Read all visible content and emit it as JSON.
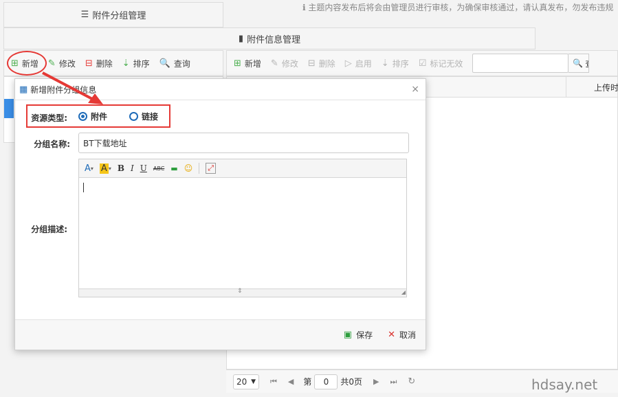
{
  "notice": "主题内容发布后将会由管理员进行审核，为确保审核通过，请认真发布，勿发布违规",
  "tabs": {
    "group_mgmt": "附件分组管理",
    "info_mgmt": "附件信息管理"
  },
  "left_toolbar": [
    "新增",
    "修改",
    "删除",
    "排序",
    "查询"
  ],
  "right_toolbar": [
    "新增",
    "修改",
    "删除",
    "启用",
    "排序",
    "标记无效"
  ],
  "search": {
    "button_label": "查"
  },
  "grid": {
    "col_upload_time": "上传时"
  },
  "dialog": {
    "title": "新增附件分组信息",
    "resource_type_label": "资源类型:",
    "radio_attachment": "附件",
    "radio_link": "链接",
    "selected_resource_type": "附件",
    "group_name_label": "分组名称:",
    "group_name_value": "BT下载地址",
    "group_desc_label": "分组描述:",
    "save_label": "保存",
    "cancel_label": "取消"
  },
  "pager": {
    "page_size": "20",
    "page_prefix": "第",
    "page_value": "0",
    "page_total": "共0页"
  },
  "watermark": "hdsay.net",
  "colors": {
    "accent": "#1e6bb8",
    "highlight": "#e53935",
    "save": "#2e9e3e",
    "cancel": "#d9302c"
  }
}
